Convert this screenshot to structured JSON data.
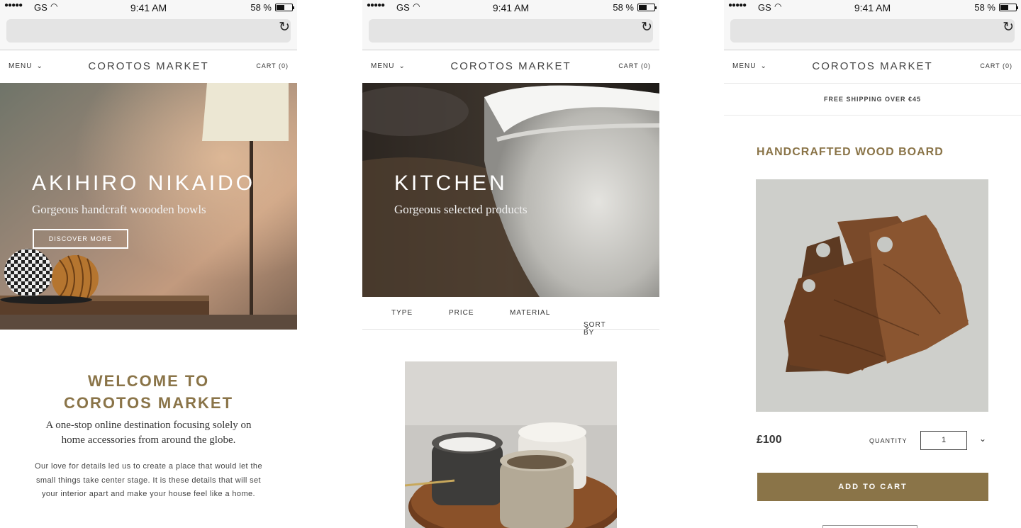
{
  "status": {
    "carrier": "GS",
    "time": "9:41 AM",
    "battery": "58 %"
  },
  "header": {
    "menu": "MENU",
    "brand": "COROTOS MARKET",
    "cart": "CART (0)"
  },
  "home": {
    "hero_title": "AKIHIRO NIKAIDO",
    "hero_subtitle": "Gorgeous handcraft woooden bowls",
    "hero_button": "DISCOVER MORE",
    "welcome_line1": "WELCOME TO",
    "welcome_line2": "COROTOS MARKET",
    "tagline": "A one-stop online destination focusing solely on home accessories from around the globe.",
    "body": "Our love for details led us to create a place that would let the small things take center stage. It is these details that will set your interior apart and make your house feel like a home."
  },
  "category": {
    "hero_title": "KITCHEN",
    "hero_subtitle": "Gorgeous  selected products",
    "filters": [
      "TYPE",
      "PRICE",
      "MATERIAL",
      "SORT BY"
    ]
  },
  "product": {
    "shipping_banner": "FREE SHIPPING OVER €45",
    "title": "HANDCRAFTED WOOD BOARD",
    "price": "£100",
    "quantity_label": "QUANTITY",
    "quantity_value": "1",
    "add_to_cart": "ADD TO CART"
  },
  "colors": {
    "accent": "#8a7448",
    "text": "#333333",
    "chrome": "#f7f7f7"
  }
}
